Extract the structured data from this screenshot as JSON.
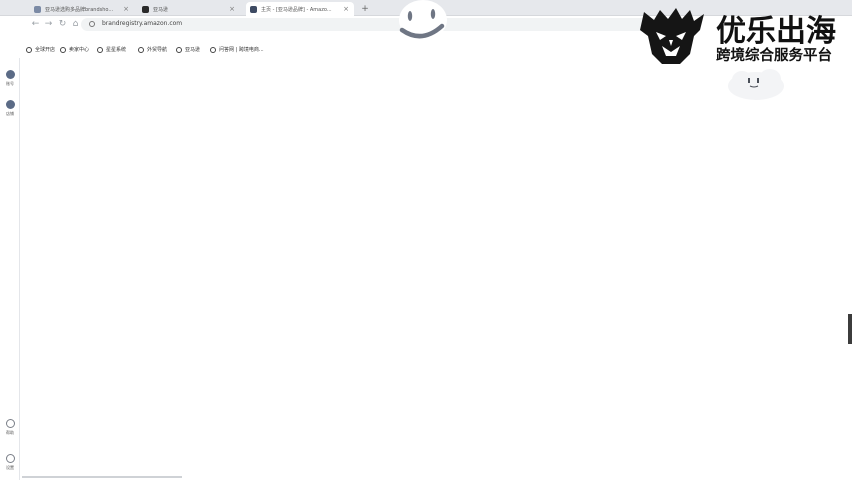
{
  "tabs": [
    {
      "label": "亚马逊选购多品牌brandsho...",
      "icon_color": "#7b8aa5"
    },
    {
      "label": "亚马逊",
      "icon_color": "#2a2a2a"
    },
    {
      "label": "主页 - [亚马逊品牌] - Amazo...",
      "icon_color": "#3e4b63"
    }
  ],
  "address": {
    "url": "brandregistry.amazon.com"
  },
  "bookmarks": [
    {
      "label": "全球开店"
    },
    {
      "label": "卖家中心"
    },
    {
      "label": "星星系统"
    },
    {
      "label": "外贸导航"
    },
    {
      "label": "亚马逊"
    },
    {
      "label": "问答网 | 跨境电商..."
    }
  ],
  "rail": {
    "top_items": [
      {
        "label": "账号"
      },
      {
        "label": "店铺"
      }
    ],
    "bottom_items": [
      {
        "label": "帮助"
      },
      {
        "label": "设置"
      }
    ]
  },
  "brand": {
    "name": "优乐出海",
    "tagline": "跨境综合服务平台"
  },
  "colors": {
    "accent": "#5b6b86",
    "text": "#111111"
  }
}
